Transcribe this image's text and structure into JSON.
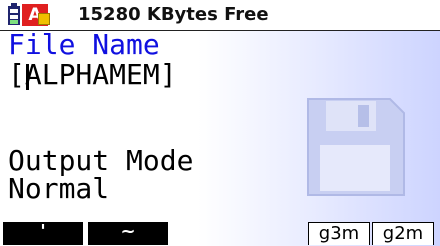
{
  "status_bar": {
    "battery_icon": "battery-icon",
    "alpha_indicator": "A",
    "free_memory": "15280 KBytes Free"
  },
  "main": {
    "file_name_heading": "File Name",
    "file_name_value": "[ALPHAMEM]",
    "output_mode_heading": "Output Mode",
    "output_mode_value": "Normal",
    "background_icon": "floppy-disk-icon"
  },
  "function_keys": [
    {
      "label": "'"
    },
    {
      "label": "~"
    },
    {
      "label": ""
    },
    {
      "label": ""
    },
    {
      "label": "g3m"
    },
    {
      "label": "g2m"
    }
  ],
  "colors": {
    "heading_blue": "#1010e0",
    "indicator_red": "#e02020",
    "battery_blue": "#20256e",
    "gradient_end": "#cdd4ff"
  }
}
